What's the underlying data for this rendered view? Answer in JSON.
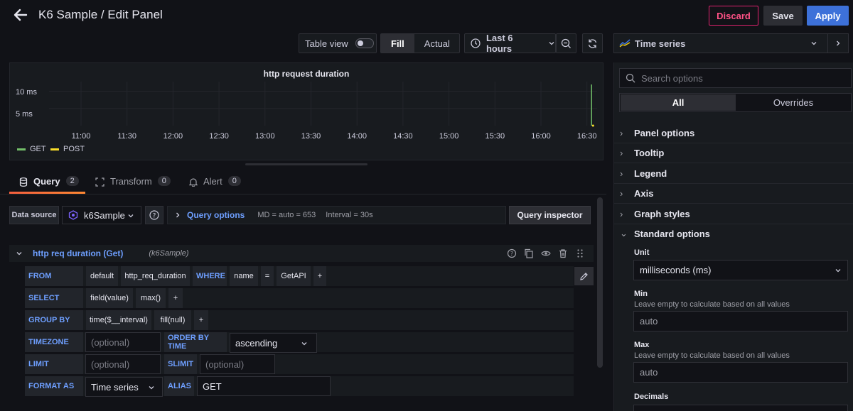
{
  "header": {
    "title": "K6 Sample / Edit Panel",
    "discard": "Discard",
    "save": "Save",
    "apply": "Apply"
  },
  "toolbar": {
    "table_view": "Table view",
    "fill": "Fill",
    "actual": "Actual",
    "time_range": "Last 6 hours",
    "viz": "Time series"
  },
  "chart_data": {
    "type": "line",
    "title": "http request duration",
    "y_ticks": [
      "10 ms",
      "5 ms"
    ],
    "x_ticks": [
      "11:00",
      "11:30",
      "12:00",
      "12:30",
      "13:00",
      "13:30",
      "14:00",
      "14:30",
      "15:00",
      "15:30",
      "16:00",
      "16:30"
    ],
    "series": [
      {
        "name": "GET",
        "color": "#73bf69",
        "x": [
          "16:33",
          "16:33"
        ],
        "values": [
          12,
          0
        ]
      },
      {
        "name": "POST",
        "color": "#fade2a",
        "x": [
          "16:34"
        ],
        "values": [
          0
        ]
      }
    ],
    "ylim": [
      0,
      12
    ]
  },
  "tabs": [
    {
      "label": "Query",
      "count": "2"
    },
    {
      "label": "Transform",
      "count": "0"
    },
    {
      "label": "Alert",
      "count": "0"
    }
  ],
  "datasource": {
    "label": "Data source",
    "name": "k6Sample",
    "query_options": "Query options",
    "md": "MD = auto = 653",
    "interval": "Interval = 30s",
    "inspector": "Query inspector"
  },
  "query": {
    "name": "http req duration (Get)",
    "ds": "(k6Sample)",
    "from": {
      "kw": "FROM",
      "policy": "default",
      "measurement": "http_req_duration",
      "where": "WHERE",
      "key": "name",
      "op": "=",
      "value": "GetAPI",
      "plus": "+"
    },
    "select": {
      "kw": "SELECT",
      "field": "field(value)",
      "agg": "max()",
      "plus": "+"
    },
    "group_by": {
      "kw": "GROUP BY",
      "time": "time($__interval)",
      "fill": "fill(null)",
      "plus": "+"
    },
    "timezone": {
      "kw": "TIMEZONE",
      "placeholder": "(optional)",
      "order_kw": "ORDER BY TIME",
      "order": "ascending"
    },
    "limit": {
      "kw": "LIMIT",
      "placeholder": "(optional)",
      "slimit_kw": "SLIMIT",
      "slimit_placeholder": "(optional)"
    },
    "format": {
      "kw": "FORMAT AS",
      "value": "Time series",
      "alias_kw": "ALIAS",
      "alias": "GET"
    }
  },
  "options": {
    "search_placeholder": "Search options",
    "all": "All",
    "overrides": "Overrides",
    "sections": [
      "Panel options",
      "Tooltip",
      "Legend",
      "Axis",
      "Graph styles"
    ],
    "standard": "Standard options",
    "unit_label": "Unit",
    "unit": "milliseconds (ms)",
    "min_label": "Min",
    "min_desc": "Leave empty to calculate based on all values",
    "min": "auto",
    "max_label": "Max",
    "max_desc": "Leave empty to calculate based on all values",
    "max": "auto",
    "decimals_label": "Decimals"
  }
}
